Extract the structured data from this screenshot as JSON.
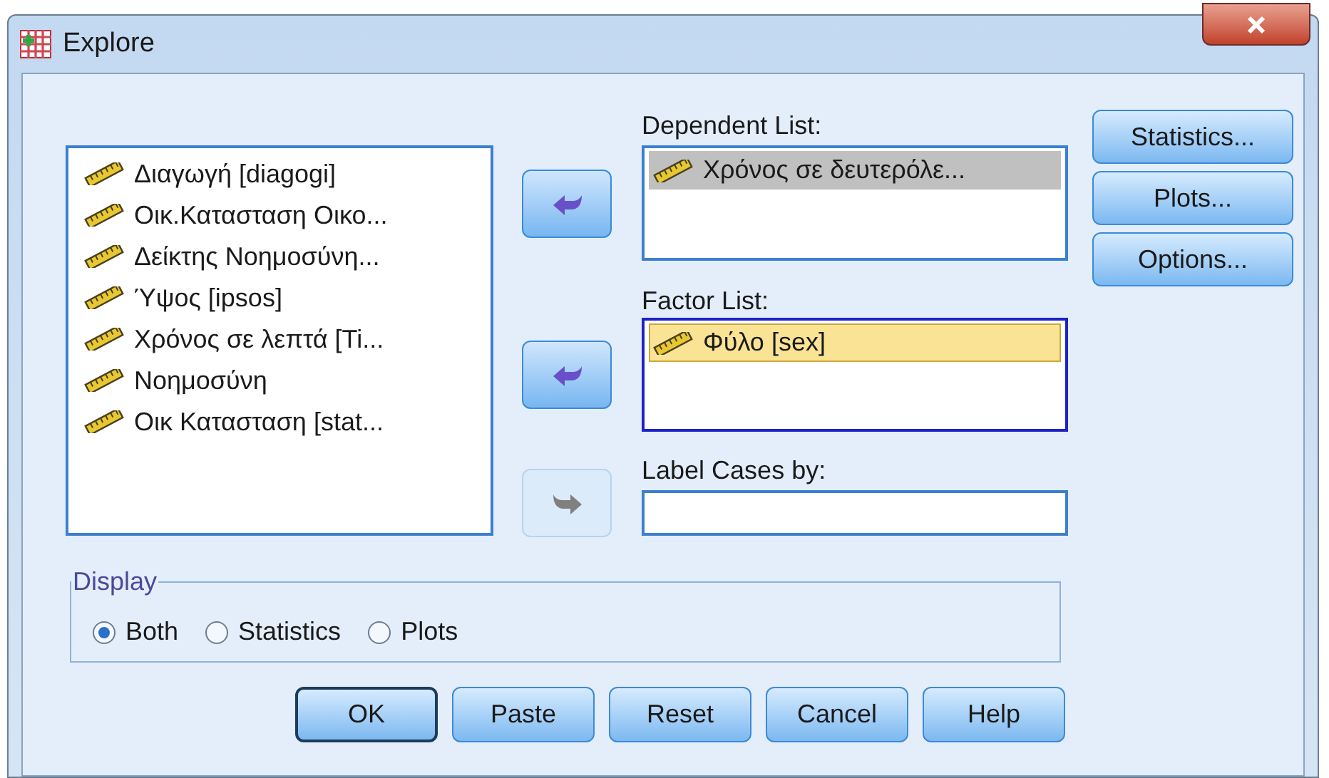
{
  "window": {
    "title": "Explore"
  },
  "variables": [
    {
      "name": "Διαγωγή [diagogi]",
      "selected": false
    },
    {
      "name": "Οικ.Κατασταση Οικο...",
      "selected": false
    },
    {
      "name": "Δείκτης Νοημοσύνη...",
      "selected": false
    },
    {
      "name": "Ύψος [ipsos]",
      "selected": false
    },
    {
      "name": "Χρόνος σε λεπτά [Ti...",
      "selected": false
    },
    {
      "name": "Νοημοσύνη",
      "selected": false
    },
    {
      "name": "Οικ Κατασταση [stat...",
      "selected": false
    }
  ],
  "move_buttons": [
    {
      "kind": "left",
      "disabled": false
    },
    {
      "kind": "left",
      "disabled": false
    },
    {
      "kind": "right",
      "disabled": true
    }
  ],
  "dependent_list": {
    "label": "Dependent List:",
    "focused": false,
    "items": [
      {
        "name": "Χρόνος σε δευτερόλε...",
        "selected": true
      }
    ]
  },
  "factor_list": {
    "label": "Factor List:",
    "focused": true,
    "items": [
      {
        "name": "Φύλο [sex]",
        "selected": true
      }
    ]
  },
  "label_cases": {
    "label": "Label Cases by:"
  },
  "side_buttons": [
    "Statistics...",
    "Plots...",
    "Options..."
  ],
  "display": {
    "title": "Display",
    "options": [
      {
        "label": "Both",
        "selected": true
      },
      {
        "label": "Statistics",
        "selected": false
      },
      {
        "label": "Plots",
        "selected": false
      }
    ]
  },
  "buttons": [
    {
      "label": "OK",
      "default": true
    },
    {
      "label": "Paste",
      "default": false
    },
    {
      "label": "Reset",
      "default": false
    },
    {
      "label": "Cancel",
      "default": false
    },
    {
      "label": "Help",
      "default": false
    }
  ]
}
